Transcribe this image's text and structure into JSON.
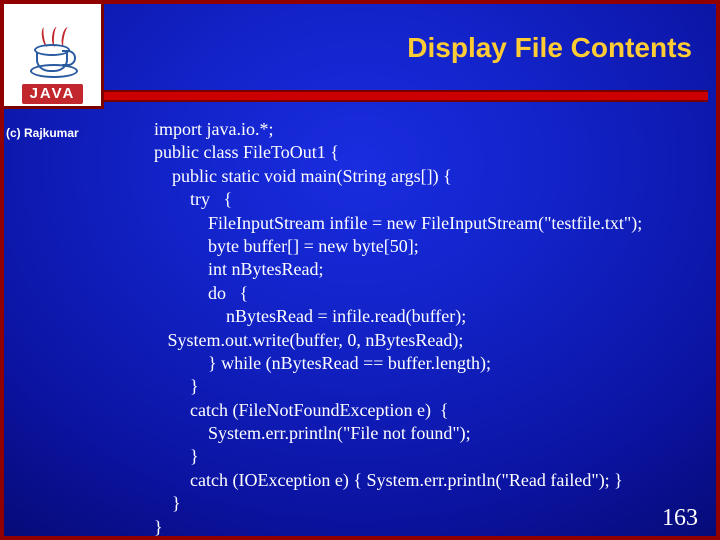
{
  "logo": {
    "word": "JAVA",
    "icon_name": "java-cup-icon"
  },
  "copyright": "(c) Rajkumar",
  "title": "Display File Contents",
  "code_text": "import java.io.*;\npublic class FileToOut1 {\n    public static void main(String args[]) {\n        try   {\n            FileInputStream infile = new FileInputStream(\"testfile.txt\");\n            byte buffer[] = new byte[50];\n            int nBytesRead;\n            do   {\n                nBytesRead = infile.read(buffer);\n   System.out.write(buffer, 0, nBytesRead);\n            } while (nBytesRead == buffer.length);\n        }\n        catch (FileNotFoundException e)  {\n            System.err.println(\"File not found\");\n        }\n        catch (IOException e) { System.err.println(\"Read failed\"); }\n    }\n}",
  "page_number": "163"
}
